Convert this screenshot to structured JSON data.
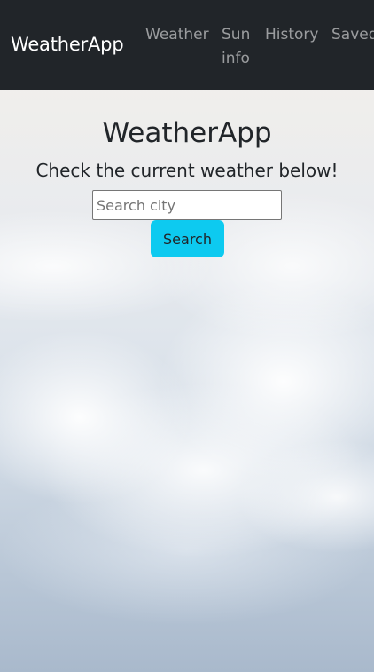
{
  "navbar": {
    "brand": "WeatherApp",
    "links": [
      "Weather",
      "Sun info",
      "History",
      "Saved"
    ]
  },
  "main": {
    "title": "WeatherApp",
    "subtitle": "Check the current weather below!",
    "search": {
      "placeholder": "Search city",
      "value": "",
      "button_label": "Search"
    }
  },
  "colors": {
    "navbar_bg": "#212529",
    "button_bg": "#0dcaf0",
    "text": "#212529"
  }
}
